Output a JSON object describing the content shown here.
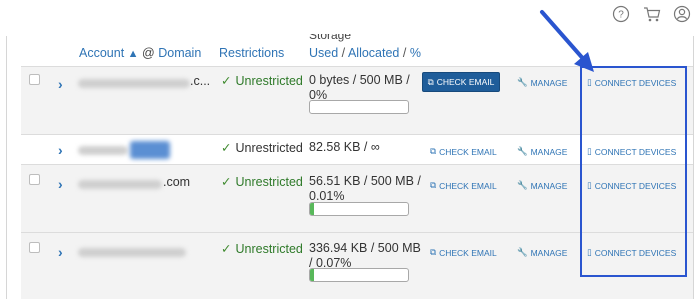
{
  "header": {
    "account_label": "Account",
    "sort_indicator": "^",
    "at_sign": "@",
    "domain_label": "Domain",
    "restrictions_label": "Restrictions",
    "storage_label": "Storage",
    "used_label": "Used",
    "slash1": "/",
    "allocated_label": "Allocated",
    "slash2": "/",
    "percent_label": "%"
  },
  "top_icons": [
    "help-icon",
    "cart-icon",
    "user-icon"
  ],
  "rows": [
    {
      "account_suffix": ".c...",
      "restriction": "Unrestricted",
      "storage_line1": "0 bytes / 500 MB /",
      "storage_line2": "0%",
      "usage_percent": 0,
      "check_email": "CHECK EMAIL",
      "manage": "MANAGE",
      "connect": "CONNECT DEVICES"
    },
    {
      "account_suffix": "",
      "restriction": "Unrestricted",
      "storage_line1": "82.58 KB / ∞",
      "storage_line2": "",
      "check_email": "CHECK EMAIL",
      "manage": "MANAGE",
      "connect": "CONNECT DEVICES"
    },
    {
      "account_suffix": ".com",
      "restriction": "Unrestricted",
      "storage_line1": "56.51 KB / 500 MB /",
      "storage_line2": "0.01%",
      "usage_percent": 0.01,
      "check_email": "CHECK EMAIL",
      "manage": "MANAGE",
      "connect": "CONNECT DEVICES"
    },
    {
      "account_suffix": "",
      "restriction": "Unrestricted",
      "storage_line1": "336.94 KB / 500 MB",
      "storage_line2": "/ 0.07%",
      "usage_percent": 0.07,
      "check_email": "CHECK EMAIL",
      "manage": "MANAGE",
      "connect": "CONNECT DEVICES"
    }
  ],
  "colors": {
    "link": "#2f74b5",
    "unrestricted": "#2f7a2a",
    "primary_button": "#1f5d9a",
    "highlight": "#2a55cf",
    "bar_fill": "#58b85a"
  }
}
